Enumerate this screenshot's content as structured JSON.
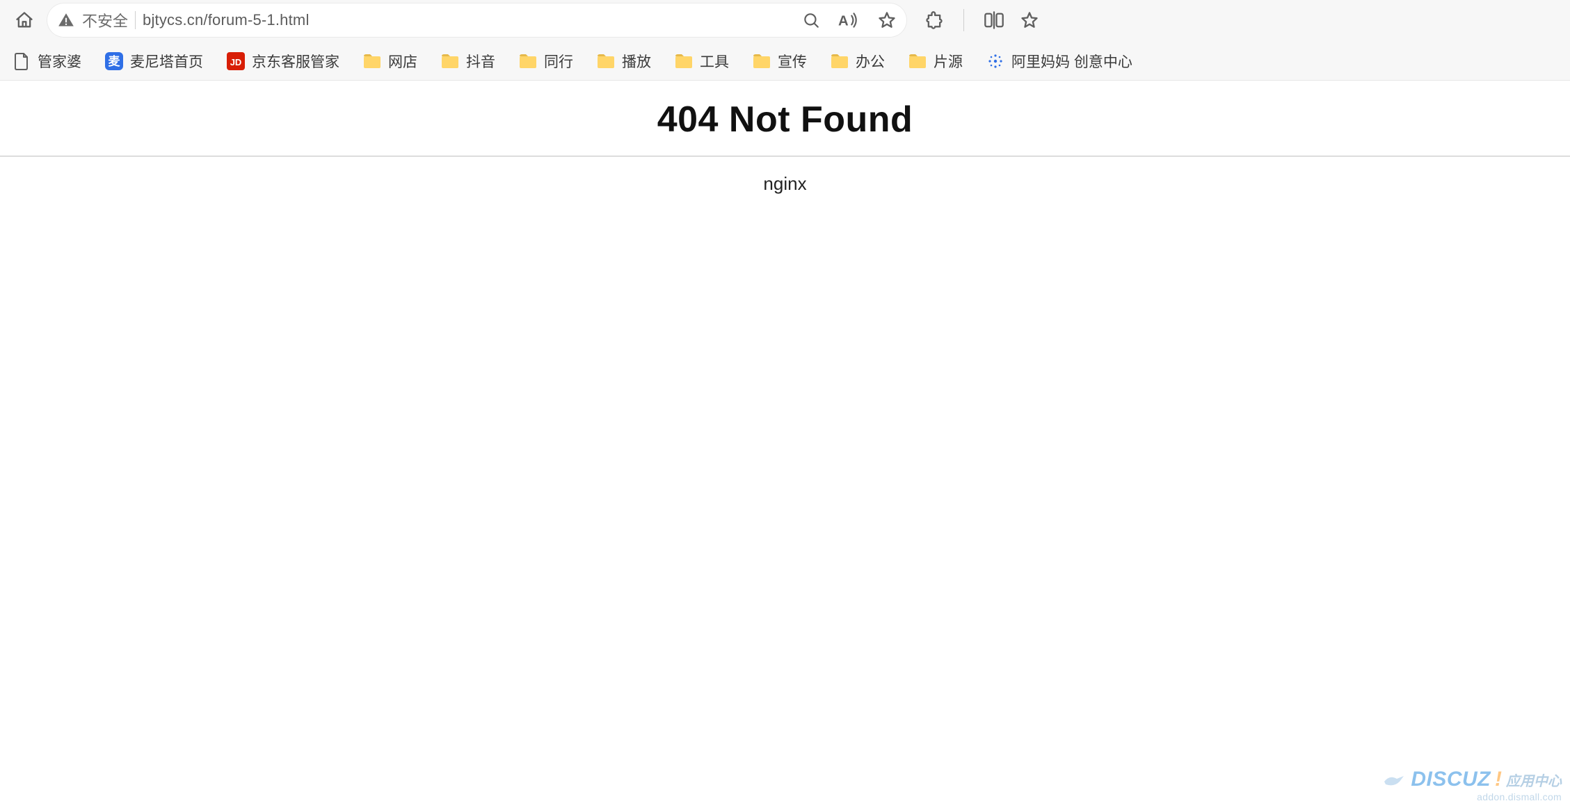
{
  "toolbar": {
    "security_label": "不安全",
    "url": "bjtycs.cn/forum-5-1.html"
  },
  "bookmarks": [
    {
      "icon": "page",
      "label": "管家婆"
    },
    {
      "icon": "mai",
      "label": "麦尼塔首页"
    },
    {
      "icon": "jd",
      "label": "京东客服管家"
    },
    {
      "icon": "folder",
      "label": "网店"
    },
    {
      "icon": "folder",
      "label": "抖音"
    },
    {
      "icon": "folder",
      "label": "同行"
    },
    {
      "icon": "folder",
      "label": "播放"
    },
    {
      "icon": "folder",
      "label": "工具"
    },
    {
      "icon": "folder",
      "label": "宣传"
    },
    {
      "icon": "folder",
      "label": "办公"
    },
    {
      "icon": "folder",
      "label": "片源"
    },
    {
      "icon": "alimama",
      "label": "阿里妈妈 创意中心"
    }
  ],
  "page": {
    "title": "404 Not Found",
    "server": "nginx"
  },
  "watermark": {
    "brand": "DISCUZ",
    "bang": "!",
    "suffix": "应用中心",
    "sub": "addon.dismall.com"
  }
}
